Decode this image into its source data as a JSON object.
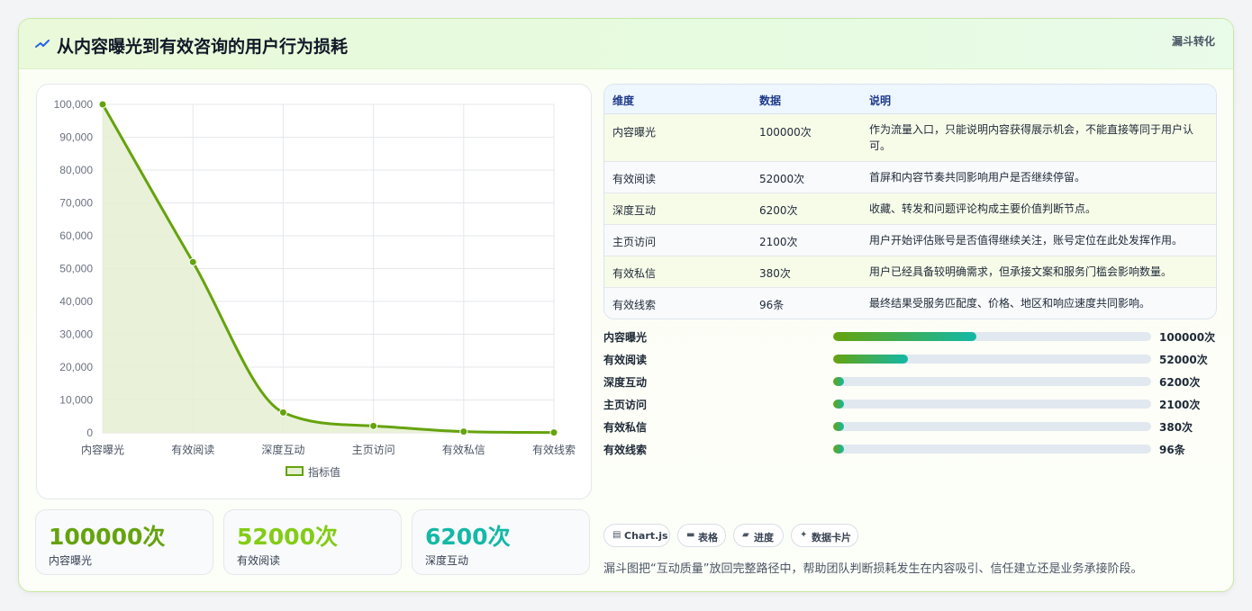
{
  "header": {
    "title": "从内容曝光到有效咨询的用户行为损耗",
    "tag": "漏斗转化"
  },
  "chart_data": {
    "type": "line",
    "categories": [
      "内容曝光",
      "有效阅读",
      "深度互动",
      "主页访问",
      "有效私信",
      "有效线索"
    ],
    "series": [
      {
        "name": "指标值",
        "values": [
          100000,
          52000,
          6200,
          2100,
          380,
          96
        ]
      }
    ],
    "yticks": [
      "0",
      "10,000",
      "20,000",
      "30,000",
      "40,000",
      "50,000",
      "60,000",
      "70,000",
      "80,000",
      "90,000",
      "100,000"
    ],
    "ylim": [
      0,
      100000
    ],
    "grid": true,
    "area_fill": true,
    "legend_position": "bottom",
    "color": "#65a30d"
  },
  "kpis": [
    {
      "value": "100000次",
      "label": "内容曝光",
      "color": "#65a30d"
    },
    {
      "value": "52000次",
      "label": "有效阅读",
      "color": "#84cc16"
    },
    {
      "value": "6200次",
      "label": "深度互动",
      "color": "#14b8a6"
    }
  ],
  "table": {
    "headers": [
      "维度",
      "数据",
      "说明"
    ],
    "rows": [
      {
        "dim": "内容曝光",
        "data": "100000次",
        "desc": "作为流量入口，只能说明内容获得展示机会，不能直接等同于用户认可。"
      },
      {
        "dim": "有效阅读",
        "data": "52000次",
        "desc": "首屏和内容节奏共同影响用户是否继续停留。"
      },
      {
        "dim": "深度互动",
        "data": "6200次",
        "desc": "收藏、转发和问题评论构成主要价值判断节点。"
      },
      {
        "dim": "主页访问",
        "data": "2100次",
        "desc": "用户开始评估账号是否值得继续关注，账号定位在此处发挥作用。"
      },
      {
        "dim": "有效私信",
        "data": "380次",
        "desc": "用户已经具备较明确需求，但承接文案和服务门槛会影响数量。"
      },
      {
        "dim": "有效线索",
        "data": "96条",
        "desc": "最终结果受服务匹配度、价格、地区和响应速度共同影响。"
      }
    ]
  },
  "progress": [
    {
      "label": "内容曝光",
      "value": "100000次",
      "fraction": 0.45
    },
    {
      "label": "有效阅读",
      "value": "52000次",
      "fraction": 0.234
    },
    {
      "label": "深度互动",
      "value": "6200次",
      "fraction": 0.028
    },
    {
      "label": "主页访问",
      "value": "2100次",
      "fraction": 0.0095
    },
    {
      "label": "有效私信",
      "value": "380次",
      "fraction": 0.0017
    },
    {
      "label": "有效线索",
      "value": "96条",
      "fraction": 0.0004
    }
  ],
  "chips": [
    {
      "icon": "chart-icon",
      "glyph": "▤",
      "label": "Chart.js"
    },
    {
      "icon": "table-icon",
      "glyph": "▬",
      "label": "表格"
    },
    {
      "icon": "progress-icon",
      "glyph": "▰",
      "label": "进度"
    },
    {
      "icon": "sparkle-icon",
      "glyph": "✦",
      "label": "数据卡片"
    }
  ],
  "footer_note": "漏斗图把“互动质量”放回完整路径中，帮助团队判断损耗发生在内容吸引、信任建立还是业务承接阶段。"
}
